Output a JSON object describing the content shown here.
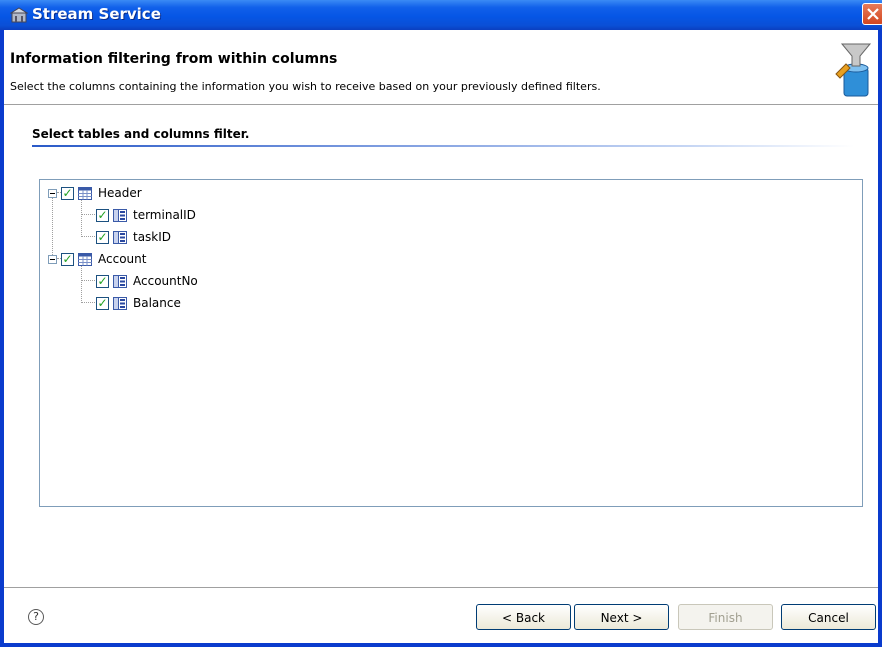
{
  "window": {
    "title": "Stream Service",
    "accent": "#0a3bcd"
  },
  "header": {
    "title": "Information filtering from within columns",
    "description": "Select the columns containing the information you wish to receive based on your previously defined filters.",
    "icon": "filter-icon"
  },
  "section": {
    "title": "Select tables and columns filter."
  },
  "tree": {
    "nodes": [
      {
        "label": "Header",
        "checked": true,
        "type": "table",
        "children": [
          {
            "label": "terminalID",
            "checked": true,
            "type": "column"
          },
          {
            "label": "taskID",
            "checked": true,
            "type": "column"
          }
        ]
      },
      {
        "label": "Account",
        "checked": true,
        "type": "table",
        "children": [
          {
            "label": "AccountNo",
            "checked": true,
            "type": "column"
          },
          {
            "label": "Balance",
            "checked": true,
            "type": "column"
          }
        ]
      }
    ]
  },
  "buttons": {
    "back": "< Back",
    "next": "Next >",
    "finish": "Finish",
    "cancel": "Cancel"
  },
  "help": {
    "glyph": "?"
  }
}
